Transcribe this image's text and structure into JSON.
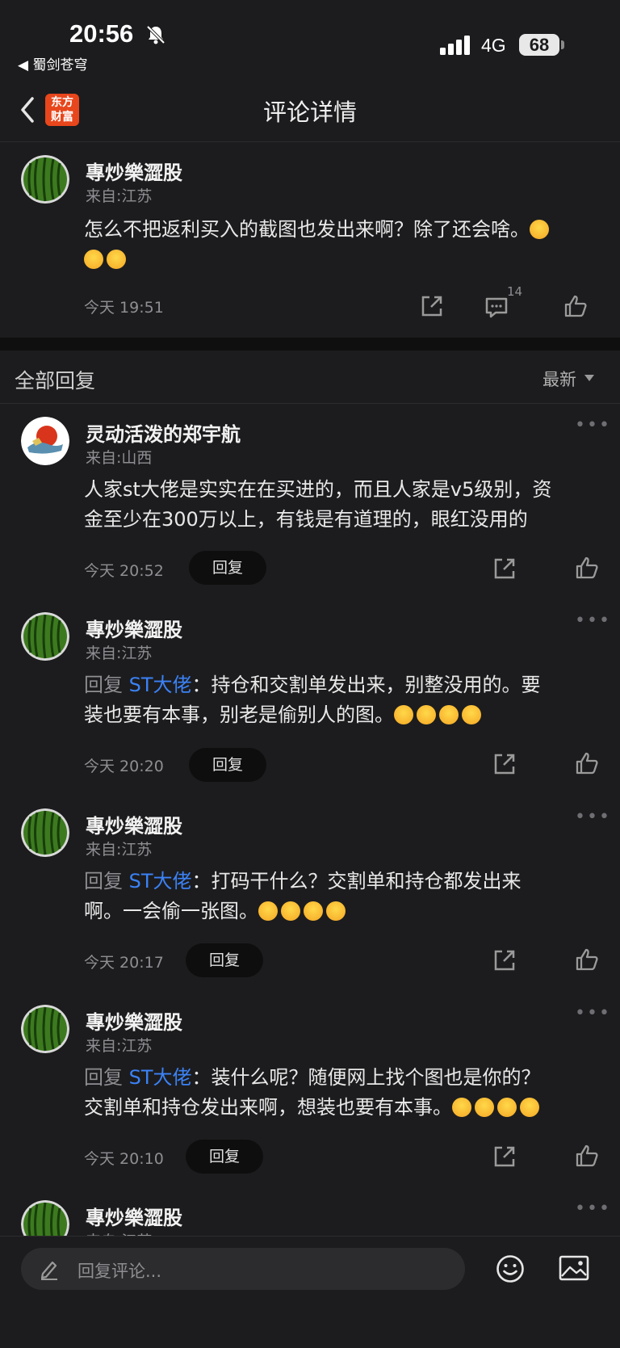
{
  "status_bar": {
    "time": "20:56",
    "back_app": "◀ 蜀剑苍穹",
    "network": "4G",
    "battery": "68"
  },
  "header": {
    "logo_line1": "东方",
    "logo_line2": "财富",
    "title": "评论详情"
  },
  "main_comment": {
    "name": "專炒樂澀股",
    "location": "来自:江苏",
    "text_line1": "怎么不把返利买入的截图也发出来啊？除了还会啥。",
    "time": "今天 19:51",
    "comment_count": "14"
  },
  "replies_section": {
    "title": "全部回复",
    "sort": "最新"
  },
  "replies": [
    {
      "name": "灵动活泼的郑宇航",
      "location": "来自:山西",
      "line1": "人家st大佬是实实在在买进的，而且人家是v5级别，资",
      "line2": "金至少在300万以上，有钱是有道理的，眼红没用的",
      "time": "今天 20:52",
      "reply_label": "回复"
    },
    {
      "name": "專炒樂澀股",
      "location": "来自:江苏",
      "prefix": "回复 ",
      "mention": "ST大佬",
      "line1": "：持仓和交割单发出来，别整没用的。要",
      "line2": "装也要有本事，别老是偷别人的图。",
      "time": "今天 20:20",
      "reply_label": "回复"
    },
    {
      "name": "專炒樂澀股",
      "location": "来自:江苏",
      "prefix": "回复 ",
      "mention": "ST大佬",
      "line1": "：打码干什么？交割单和持仓都发出来",
      "line2": "啊。一会偷一张图。",
      "time": "今天 20:17",
      "reply_label": "回复"
    },
    {
      "name": "專炒樂澀股",
      "location": "来自:江苏",
      "prefix": "回复 ",
      "mention": "ST大佬",
      "line1": "：装什么呢？随便网上找个图也是你的？",
      "line2": "交割单和持仓发出来啊，想装也要有本事。",
      "time": "今天 20:10",
      "reply_label": "回复"
    },
    {
      "name": "專炒樂澀股",
      "location": "来自:江苏"
    }
  ],
  "bottom_bar": {
    "placeholder": "回复评论..."
  },
  "icons": {
    "more": "more-dots-icon",
    "share": "share-icon",
    "comment": "comment-icon",
    "like": "thumbs-up-icon",
    "emoji": "smile-icon",
    "image": "image-icon",
    "pencil": "pencil-icon"
  },
  "colors": {
    "background": "#1c1c1e",
    "mention": "#3b82f6",
    "brand": "#e8461c"
  }
}
